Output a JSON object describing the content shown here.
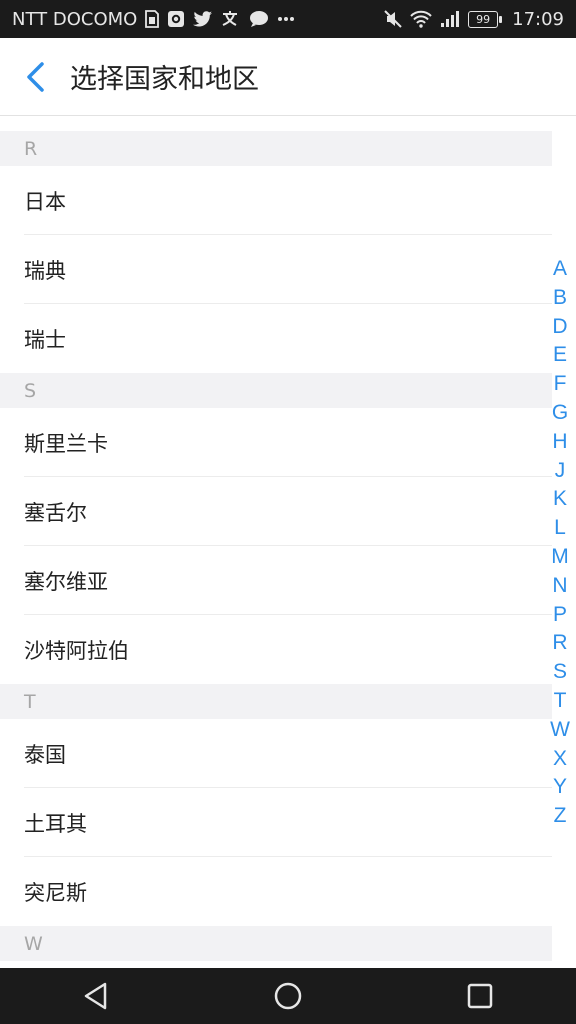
{
  "status_bar": {
    "carrier": "NTT DOCOMO",
    "battery": "99",
    "time": "17:09"
  },
  "header": {
    "title": "选择国家和地区"
  },
  "sections": [
    {
      "letter": "R",
      "items": [
        "日本",
        "瑞典",
        "瑞士"
      ]
    },
    {
      "letter": "S",
      "items": [
        "斯里兰卡",
        "塞舌尔",
        "塞尔维亚",
        "沙特阿拉伯"
      ]
    },
    {
      "letter": "T",
      "items": [
        "泰国",
        "土耳其",
        "突尼斯"
      ]
    },
    {
      "letter": "W",
      "items": []
    }
  ],
  "index_letters": [
    "A",
    "B",
    "D",
    "E",
    "F",
    "G",
    "H",
    "J",
    "K",
    "L",
    "M",
    "N",
    "P",
    "R",
    "S",
    "T",
    "W",
    "X",
    "Y",
    "Z"
  ],
  "colors": {
    "accent": "#2e8ee8",
    "section_bg": "#f2f2f4",
    "bar_bg": "#1b1b1b"
  }
}
